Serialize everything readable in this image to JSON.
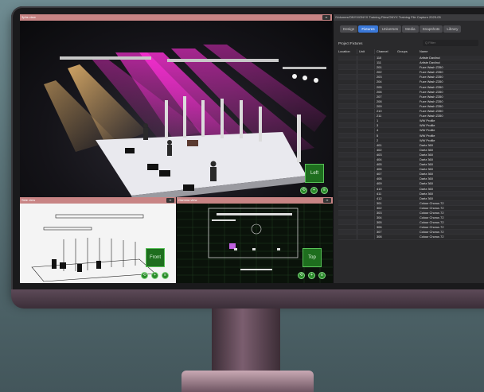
{
  "windows": {
    "view_3d_title": "3phs view",
    "side_view_title": "Side view",
    "top_view_title": "Gamma view",
    "panel_title": "/Volumes/ONYX/ONYX Training Files/ONYX Training File Capture 2025-05"
  },
  "viewcubes": {
    "view_3d": "Left",
    "side": "Front",
    "top": "Top"
  },
  "tabs": [
    {
      "label": "Design",
      "active": false
    },
    {
      "label": "Fixtures",
      "active": true
    },
    {
      "label": "Universes",
      "active": false
    },
    {
      "label": "Media",
      "active": false
    },
    {
      "label": "Snapshots",
      "active": false
    },
    {
      "label": "Library",
      "active": false
    }
  ],
  "panel": {
    "section_label": "Project Fixtures",
    "filter_placeholder": "Q Filter",
    "columns": [
      "Location",
      "Unit",
      "Channel",
      "Groups",
      "Name"
    ]
  },
  "rows": [
    [
      "110",
      "Artiste Daviinci"
    ],
    [
      "111",
      "Artiste Daviinci"
    ],
    [
      "201",
      "Fuze Wash Z350"
    ],
    [
      "202",
      "Fuze Wash Z350"
    ],
    [
      "203",
      "Fuze Wash Z350"
    ],
    [
      "204",
      "Fuze Wash Z350"
    ],
    [
      "205",
      "Fuze Wash Z350"
    ],
    [
      "206",
      "Fuze Wash Z350"
    ],
    [
      "207",
      "Fuze Wash Z350"
    ],
    [
      "208",
      "Fuze Wash Z350"
    ],
    [
      "209",
      "Fuze Wash Z350"
    ],
    [
      "210",
      "Fuze Wash Z350"
    ],
    [
      "211",
      "Fuze Wash Z350"
    ],
    [
      "1",
      "WW Profile"
    ],
    [
      "3",
      "WW Profile"
    ],
    [
      "4",
      "WW Profile"
    ],
    [
      "5",
      "WW Profile"
    ],
    [
      "2",
      "WW Profile"
    ],
    [
      "401",
      "Dartz 360"
    ],
    [
      "402",
      "Dartz 360"
    ],
    [
      "403",
      "Dartz 360"
    ],
    [
      "404",
      "Dartz 360"
    ],
    [
      "405",
      "Dartz 360"
    ],
    [
      "406",
      "Dartz 360"
    ],
    [
      "407",
      "Dartz 360"
    ],
    [
      "408",
      "Dartz 360"
    ],
    [
      "409",
      "Dartz 360"
    ],
    [
      "410",
      "Dartz 360"
    ],
    [
      "411",
      "Dartz 360"
    ],
    [
      "412",
      "Dartz 360"
    ],
    [
      "301",
      "Colour Chorus 72"
    ],
    [
      "302",
      "Colour Chorus 72"
    ],
    [
      "303",
      "Colour Chorus 72"
    ],
    [
      "304",
      "Colour Chorus 72"
    ],
    [
      "305",
      "Colour Chorus 72"
    ],
    [
      "306",
      "Colour Chorus 72"
    ],
    [
      "307",
      "Colour Chorus 72"
    ],
    [
      "308",
      "Colour Chorus 72"
    ]
  ]
}
